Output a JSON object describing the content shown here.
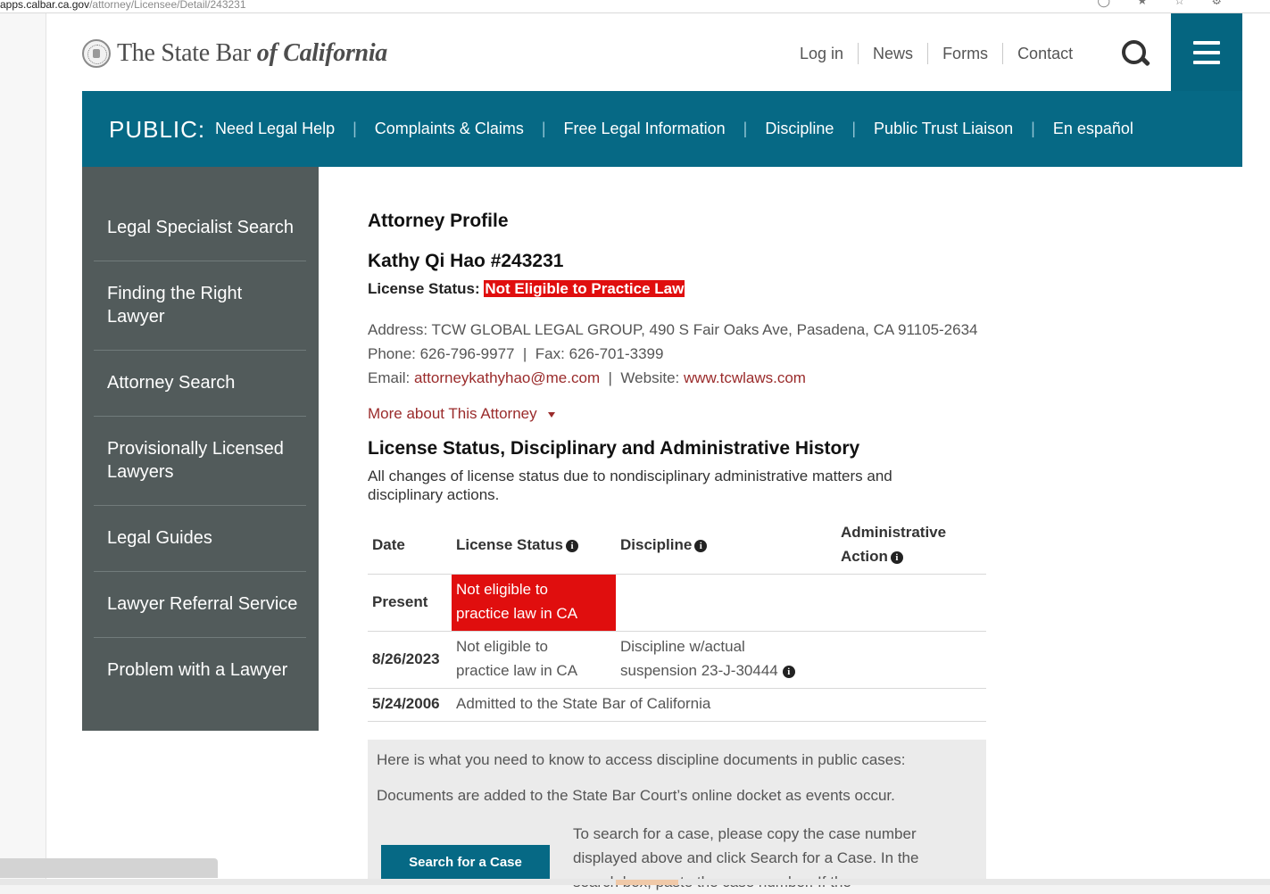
{
  "browser": {
    "url_host": "apps.calbar.ca.gov",
    "url_path": "/attorney/Licensee/Detail/243231"
  },
  "header": {
    "logo_text": "The State Bar",
    "logo_of": "of",
    "logo_state": "California",
    "nav": [
      "Log in",
      "News",
      "Forms",
      "Contact"
    ]
  },
  "public_bar": {
    "label": "PUBLIC:",
    "links": [
      "Need Legal Help",
      "Complaints & Claims",
      "Free Legal Information",
      "Discipline",
      "Public Trust Liaison",
      "En español"
    ]
  },
  "sidebar": {
    "items": [
      "Legal Specialist Search",
      "Finding the Right Lawyer",
      "Attorney Search",
      "Provisionally Licensed Lawyers",
      "Legal Guides",
      "Lawyer Referral Service",
      "Problem with a Lawyer"
    ]
  },
  "profile": {
    "heading": "Attorney Profile",
    "name": "Kathy Qi Hao #243231",
    "status_label": "License Status:",
    "status_value": "Not Eligible to Practice Law",
    "address": "Address: TCW GLOBAL LEGAL GROUP, 490 S Fair Oaks Ave, Pasadena, CA 91105-2634",
    "phone": "Phone: 626-796-9977",
    "fax": "Fax: 626-701-3399",
    "email_label": "Email:",
    "email": "attorneykathyhao@me.com",
    "website_label": "Website:",
    "website": "www.tcwlaws.com",
    "more": "More about This Attorney"
  },
  "history": {
    "heading": "License Status, Disciplinary and Administrative History",
    "description": "All changes of license status due to nondisciplinary administrative matters and disciplinary actions.",
    "columns": {
      "date": "Date",
      "status": "License Status",
      "discipline": "Discipline",
      "admin_line1": "Administrative",
      "admin_line2": "Action"
    },
    "rows": [
      {
        "date": "Present",
        "status1": "Not eligible to",
        "status2": "practice law in CA",
        "discipline1": "",
        "discipline2": ""
      },
      {
        "date": "8/26/2023",
        "status1": "Not eligible to",
        "status2": "practice law in CA",
        "discipline1": "Discipline w/actual",
        "discipline2": "suspension 23-J-30444"
      },
      {
        "date": "5/24/2006",
        "status": "Admitted to the State Bar of California"
      }
    ]
  },
  "documents": {
    "intro": "Here is what you need to know to access discipline documents in public cases:",
    "docket": "Documents are added to the State Bar Court’s online docket as events occur.",
    "button": "Search for a Case",
    "instr1": "To search for a case, please copy the case number",
    "instr2": "displayed above and click Search for a Case. In the",
    "instr3": "search box, paste the case number. If the"
  },
  "colors": {
    "brand_teal": "#066985",
    "menu_teal": "#056580",
    "sidebar_gray": "#525b5b",
    "status_red": "#e00e0e",
    "link_red": "#9a2b2b"
  }
}
